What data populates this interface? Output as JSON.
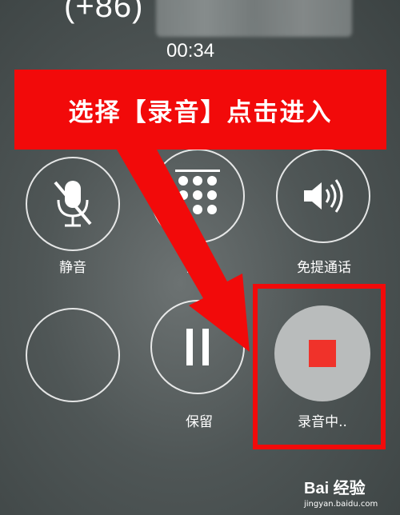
{
  "call": {
    "number_prefix": "(+86)",
    "duration": "00:34"
  },
  "annotation": {
    "banner_text": "选择【录音】点击进入",
    "color": "#f20a0a"
  },
  "controls": [
    {
      "label": "静音",
      "icon": "mute-icon"
    },
    {
      "label": "键盘",
      "icon": "keypad-icon"
    },
    {
      "label": "免提通话",
      "icon": "speaker-icon"
    },
    {
      "label": "",
      "icon": ""
    },
    {
      "label": "保留",
      "icon": "pause-icon"
    },
    {
      "label": "录音中..",
      "icon": "stop-record-icon",
      "accent": "#f0322a"
    }
  ],
  "watermark": {
    "logo": "Bai 经验",
    "url": "jingyan.baidu.com"
  }
}
